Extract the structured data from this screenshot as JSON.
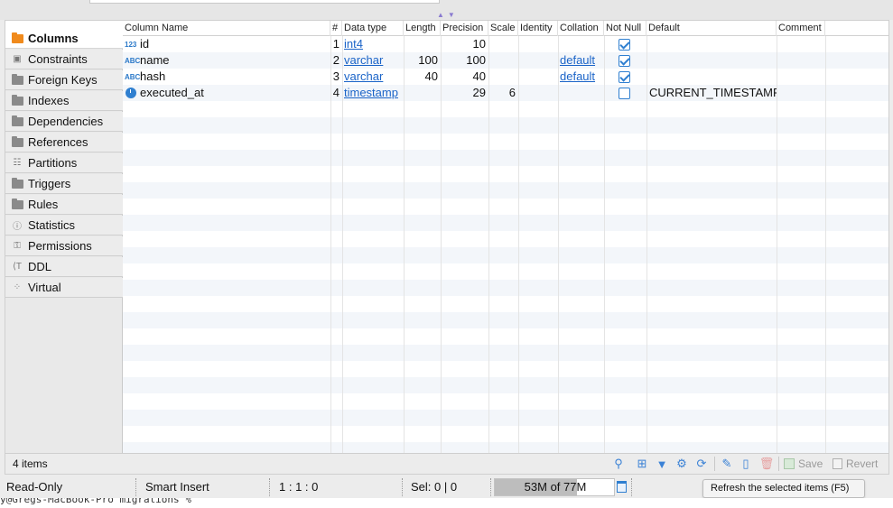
{
  "tabs": [
    {
      "label": "Columns",
      "icon": "columns-icon",
      "active": true
    },
    {
      "label": "Constraints",
      "icon": "constraints-icon"
    },
    {
      "label": "Foreign Keys",
      "icon": "folder-icon"
    },
    {
      "label": "Indexes",
      "icon": "folder-icon"
    },
    {
      "label": "Dependencies",
      "icon": "folder-icon"
    },
    {
      "label": "References",
      "icon": "folder-icon"
    },
    {
      "label": "Partitions",
      "icon": "partitions-icon"
    },
    {
      "label": "Triggers",
      "icon": "folder-icon"
    },
    {
      "label": "Rules",
      "icon": "folder-icon"
    },
    {
      "label": "Statistics",
      "icon": "info-icon"
    },
    {
      "label": "Permissions",
      "icon": "permissions-icon"
    },
    {
      "label": "DDL",
      "icon": "ddl-icon"
    },
    {
      "label": "Virtual",
      "icon": "virtual-icon"
    }
  ],
  "grid": {
    "headers": {
      "column_name": "Column Name",
      "num": "#",
      "data_type": "Data type",
      "length": "Length",
      "precision": "Precision",
      "scale": "Scale",
      "identity": "Identity",
      "collation": "Collation",
      "not_null": "Not Null",
      "default": "Default",
      "comment": "Comment"
    },
    "rows": [
      {
        "type_icon": "123",
        "name": "id",
        "num": "1",
        "data_type": "int4",
        "length": "",
        "precision": "10",
        "scale": "",
        "identity": "",
        "collation": "",
        "not_null": true,
        "default": "",
        "comment": ""
      },
      {
        "type_icon": "ABC",
        "name": "name",
        "num": "2",
        "data_type": "varchar",
        "length": "100",
        "precision": "100",
        "scale": "",
        "identity": "",
        "collation": "default",
        "not_null": true,
        "default": "",
        "comment": ""
      },
      {
        "type_icon": "ABC",
        "name": "hash",
        "num": "3",
        "data_type": "varchar",
        "length": "40",
        "precision": "40",
        "scale": "",
        "identity": "",
        "collation": "default",
        "not_null": true,
        "default": "",
        "comment": ""
      },
      {
        "type_icon": "clock",
        "name": "executed_at",
        "num": "4",
        "data_type": "timestamp",
        "length": "",
        "precision": "29",
        "scale": "6",
        "identity": "",
        "collation": "",
        "not_null": false,
        "default": "CURRENT_TIMESTAMP",
        "comment": ""
      }
    ]
  },
  "footer": {
    "items_count": "4 items",
    "save_label": "Save",
    "revert_label": "Revert"
  },
  "status": {
    "mode": "Read-Only",
    "insert_mode": "Smart Insert",
    "position": "1 : 1 : 0",
    "selection": "Sel: 0 | 0",
    "memory": "53M of 77M",
    "memory_fraction": 0.69
  },
  "tooltip": "Refresh the selected items (F5)",
  "terminal_line": "y@Gregs-MacBook-Pro migrations % "
}
